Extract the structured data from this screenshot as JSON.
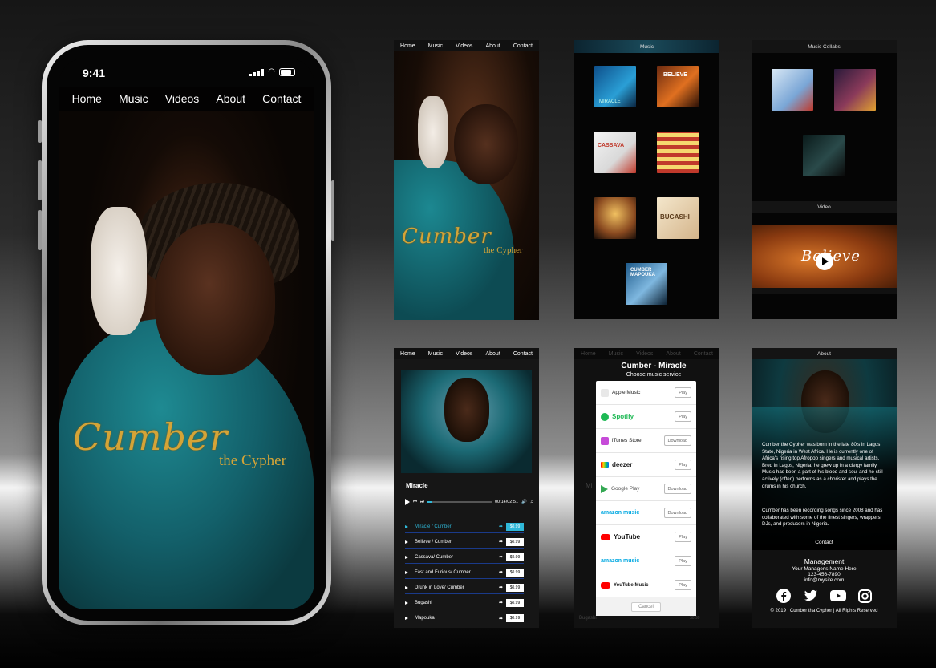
{
  "phone": {
    "status_time": "9:41",
    "nav": [
      "Home",
      "Music",
      "Videos",
      "About",
      "Contact"
    ],
    "logo_script": "Cumber",
    "logo_sub": "the Cypher"
  },
  "screen_home": {
    "nav": [
      "Home",
      "Music",
      "Videos",
      "About",
      "Contact"
    ],
    "logo_script": "Cumber",
    "logo_sub": "the Cypher"
  },
  "screen_music": {
    "title": "Music",
    "cover_texts": [
      "MIRACLE",
      "BELIEVE",
      "CASSAVA",
      "",
      "",
      "BUGASHI",
      "CUMBER\nMAPOUKA"
    ]
  },
  "screen_collabs": {
    "title": "Music Collabs",
    "video_title": "Video",
    "video_text": "Believe"
  },
  "screen_player": {
    "nav": [
      "Home",
      "Music",
      "Videos",
      "About",
      "Contact"
    ],
    "now_playing": "Miracle",
    "time": "00:14/02:51",
    "tracks": [
      {
        "title": "Miracle / Cumber",
        "price": "$0.99",
        "active": true
      },
      {
        "title": "Believe / Cumber",
        "price": "$0.99",
        "active": false
      },
      {
        "title": "Cassava/ Cumber",
        "price": "$0.99",
        "active": false
      },
      {
        "title": "Fast and Furious/ Cumber",
        "price": "$0.99",
        "active": false
      },
      {
        "title": "Drunk in Love/ Cumber",
        "price": "$0.99",
        "active": false
      },
      {
        "title": "Bugashi",
        "price": "$0.99",
        "active": false
      },
      {
        "title": "Mapouka",
        "price": "$0.99",
        "active": false
      }
    ]
  },
  "screen_services": {
    "nav": [
      "Home",
      "Music",
      "Videos",
      "About",
      "Contact"
    ],
    "title": "Cumber - Miracle",
    "subtitle": "Choose music service",
    "services": [
      {
        "name": "Apple Music",
        "action": "Play",
        "color": "#e8e8e8",
        "icon": "apple-icon"
      },
      {
        "name": "Spotify",
        "action": "Play",
        "color": "#1db954",
        "icon": "spotify-icon"
      },
      {
        "name": "iTunes Store",
        "action": "Download",
        "color": "#c64bd8",
        "icon": "itunes-icon"
      },
      {
        "name": "deezer",
        "action": "Play",
        "color": "#222222",
        "icon": "deezer-icon"
      },
      {
        "name": "Google Play",
        "action": "Download",
        "color": "#34a853",
        "icon": "google-play-icon"
      },
      {
        "name": "amazon music",
        "action": "Download",
        "color": "#00a8e1",
        "icon": "amazon-icon"
      },
      {
        "name": "YouTube",
        "action": "Play",
        "color": "#ff0000",
        "icon": "youtube-icon"
      },
      {
        "name": "amazon music",
        "action": "Play",
        "color": "#00a8e1",
        "icon": "amazon-icon"
      },
      {
        "name": "YouTube Music",
        "action": "Play",
        "color": "#ff0000",
        "icon": "youtube-music-icon"
      }
    ],
    "cancel": "Cancel",
    "bg_labels": [
      "Mi",
      "Bugashi",
      "$0.99"
    ]
  },
  "screen_about": {
    "title": "About",
    "bio_1": "Cumber the Cypher was born in the late 80's in Lagos State, Nigeria in West Africa. He is currently one of Africa's rising top Afropop singers and musical artists. Bred in Lagos, Nigeria, he grew up in a clergy family. Music has been a part of his blood and soul and he still actively (often) performs as a chorister and plays the drums in his church.",
    "bio_2": "Cumber has been recording songs since 2008 and has collaborated with some of the finest singers, wrappers, DJs, and producers in Nigeria.",
    "contact_heading": "Contact",
    "management": "Management",
    "manager_name": "Your Manager's Name Here",
    "phone": "123-456-7890",
    "email": "info@mysite.com",
    "social_icons": [
      "facebook-icon",
      "twitter-icon",
      "youtube-icon",
      "instagram-icon"
    ],
    "copyright": "© 2019 | Cumber tha Cypher | All Rights Reserved"
  }
}
